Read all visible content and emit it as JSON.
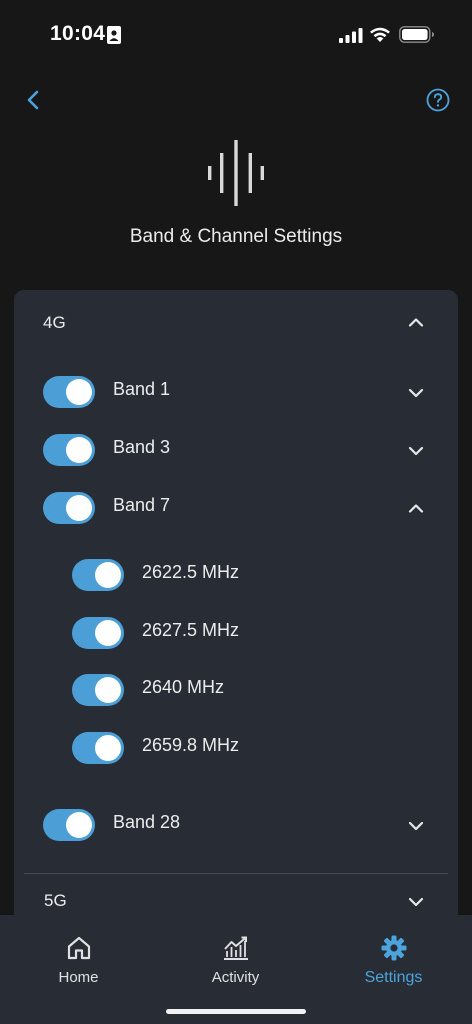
{
  "status_bar": {
    "time": "10:04"
  },
  "header": {
    "title": "Band & Channel Settings"
  },
  "sections": [
    {
      "label": "4G",
      "expanded": true,
      "bands": [
        {
          "label": "Band 1",
          "enabled": true,
          "expanded": false
        },
        {
          "label": "Band 3",
          "enabled": true,
          "expanded": false
        },
        {
          "label": "Band 7",
          "enabled": true,
          "expanded": true,
          "channels": [
            {
              "label": "2622.5 MHz",
              "enabled": true
            },
            {
              "label": "2627.5 MHz",
              "enabled": true
            },
            {
              "label": "2640 MHz",
              "enabled": true
            },
            {
              "label": "2659.8 MHz",
              "enabled": true
            }
          ]
        },
        {
          "label": "Band 28",
          "enabled": true,
          "expanded": false
        }
      ]
    },
    {
      "label": "5G",
      "expanded": false
    }
  ],
  "tab_bar": {
    "tabs": [
      {
        "label": "Home",
        "icon": "home-icon",
        "active": false
      },
      {
        "label": "Activity",
        "icon": "activity-icon",
        "active": false
      },
      {
        "label": "Settings",
        "icon": "gear-icon",
        "active": true
      }
    ]
  },
  "colors": {
    "accent": "#4da3dc",
    "toggle_on": "#4b9fd6",
    "panel": "#282d35",
    "background": "#171717"
  }
}
